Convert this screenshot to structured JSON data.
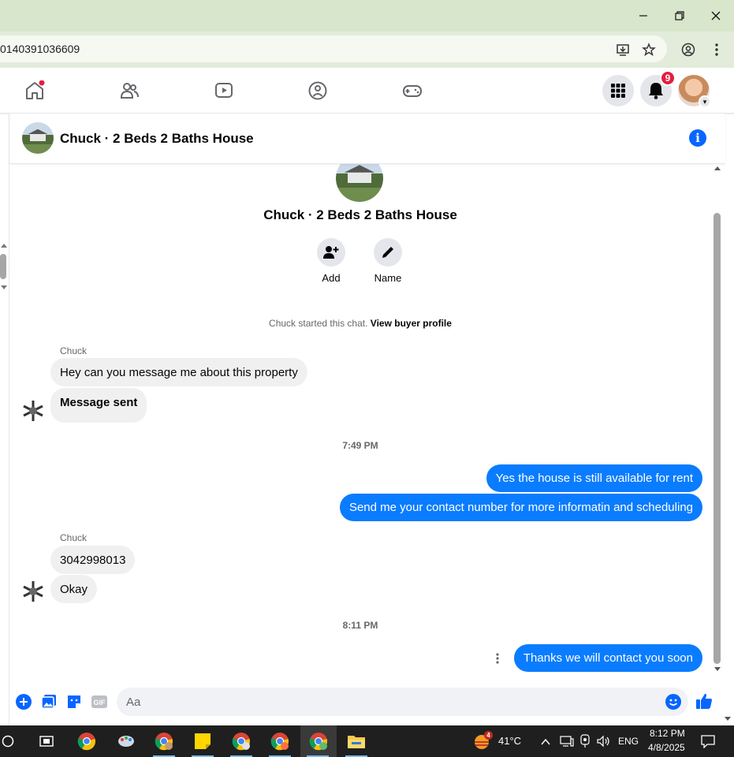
{
  "browser": {
    "url": "0140391036609"
  },
  "notifications": {
    "count": "9"
  },
  "chat": {
    "title": "Chuck · 2 Beds 2 Baths House",
    "center_title": "Chuck · 2 Beds 2 Baths House",
    "actions": [
      {
        "label": "Add",
        "icon": "add-person-icon"
      },
      {
        "label": "Name",
        "icon": "pencil-icon"
      }
    ],
    "system_text": "Chuck started this chat.",
    "system_link": "View buyer profile",
    "messages": [
      {
        "sender": "Chuck",
        "text": "Hey can you message me about this property"
      },
      {
        "text": "Message sent"
      },
      {
        "timestamp": "7:49 PM"
      },
      {
        "text": "Yes the house is still available for rent"
      },
      {
        "text": "Send me your contact number for more informatin and  scheduling"
      },
      {
        "sender": "Chuck",
        "text": "3042998013"
      },
      {
        "text": "Okay"
      },
      {
        "timestamp": "8:11 PM"
      },
      {
        "text": "Thanks we will contact you soon"
      }
    ],
    "composer_placeholder": "Aa"
  },
  "taskbar": {
    "weather_badge": "4",
    "temperature": "41°C",
    "language": "ENG",
    "time": "8:12 PM",
    "date": "4/8/2025"
  },
  "colors": {
    "messenger_blue": "#0a7cff",
    "fb_blue": "#0866ff",
    "badge_red": "#e41e3f"
  }
}
